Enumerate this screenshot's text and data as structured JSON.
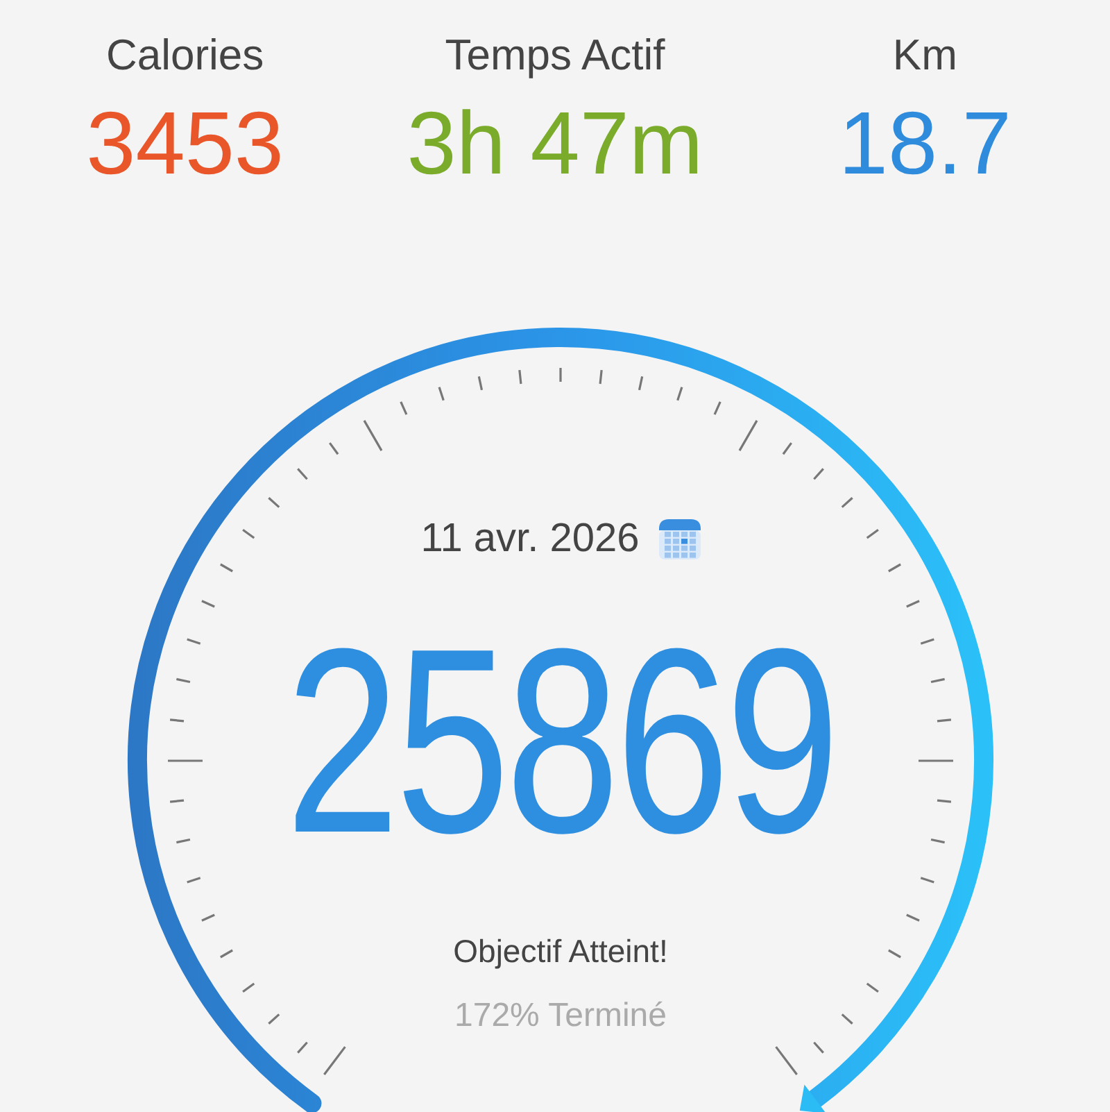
{
  "stats": [
    {
      "label": "Calories",
      "value": "3453",
      "color": "#e8562a"
    },
    {
      "label": "Temps Actif",
      "value": "3h 47m",
      "color": "#7aab2a"
    },
    {
      "label": "Km",
      "value": "18.7",
      "color": "#2f8bdc"
    }
  ],
  "gauge": {
    "date": "11 avr. 2026",
    "steps": "25869",
    "status": "Objectif Atteint!",
    "progress": "172% Terminé"
  }
}
